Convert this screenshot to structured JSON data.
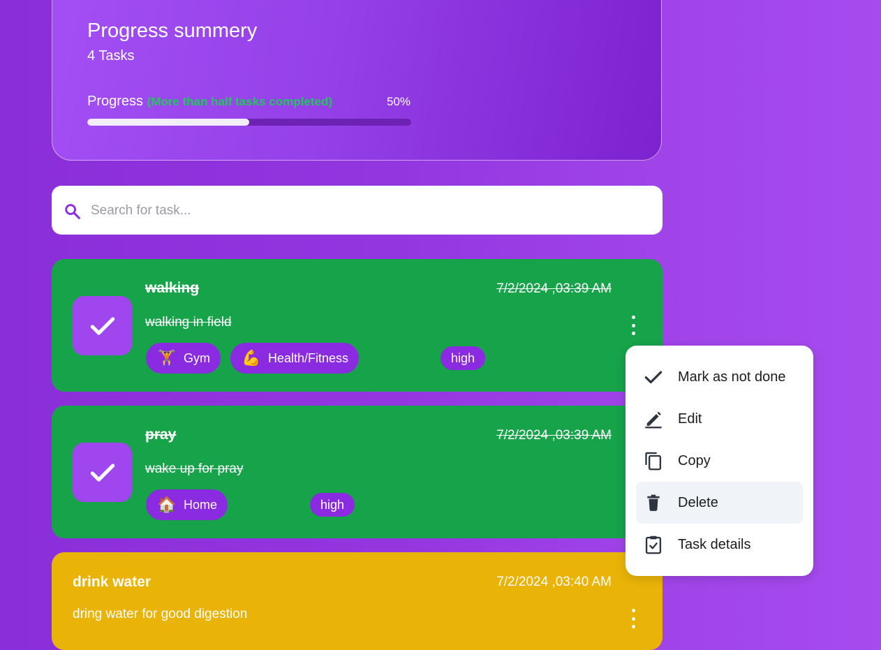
{
  "summary": {
    "title": "Progress summery",
    "count": "4 Tasks",
    "progress_label": "Progress",
    "progress_note": "(More than half tasks completed)",
    "progress_percent": "50%",
    "progress_value": 0.5
  },
  "search": {
    "placeholder": "Search for task..."
  },
  "tasks": [
    {
      "title": "walking",
      "date": "7/2/2024 ,03:39 AM",
      "description": "walking in field",
      "done": true,
      "tags": [
        {
          "emoji": "🏋️",
          "label": "Gym"
        },
        {
          "emoji": "💪",
          "label": "Health/Fitness"
        }
      ],
      "priority": "high"
    },
    {
      "title": "pray",
      "date": "7/2/2024 ,03:39 AM",
      "description": "wake up for pray",
      "done": true,
      "tags": [
        {
          "emoji": "🏠",
          "label": "Home"
        }
      ],
      "priority": "high"
    },
    {
      "title": "drink water",
      "date": "7/2/2024 ,03:40 AM",
      "description": "dring water for good digestion",
      "done": false
    }
  ],
  "menu": {
    "items": [
      {
        "label": "Mark as not done",
        "icon": "check-icon"
      },
      {
        "label": "Edit",
        "icon": "pencil-icon"
      },
      {
        "label": "Copy",
        "icon": "copy-icon"
      },
      {
        "label": "Delete",
        "icon": "trash-icon",
        "active": true
      },
      {
        "label": "Task details",
        "icon": "clipboard-check-icon"
      }
    ]
  },
  "colors": {
    "completed_card": "#16a34a",
    "pending_card": "#eab308",
    "accent": "#8a2be2",
    "progress_note": "#22c55e"
  }
}
